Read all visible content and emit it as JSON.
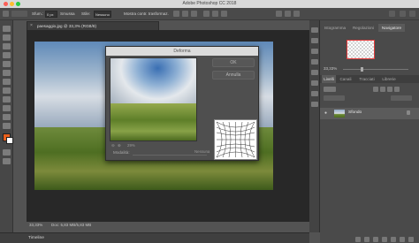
{
  "window": {
    "title": "Adobe Photoshop CC 2018"
  },
  "options_bar": {
    "feather_label": "Sfum.:",
    "feather_value": "0 px",
    "style_label": "Stile:",
    "style_value": "Nessuno",
    "smooth_label": "Smussa",
    "transform_button": "Mostra contr. trasformaz."
  },
  "document": {
    "tab_title": "paesaggio.jpg @ 33,3% (RGB/8)",
    "zoom_status": "33,33%",
    "doc_size": "Doc: 5,83 MB/5,83 MB"
  },
  "dialog": {
    "title": "Deforma",
    "ok_label": "OK",
    "cancel_label": "Annulla",
    "zoom_value": "29%",
    "mode_label": "Modalità:",
    "mode_value": "Nessuna"
  },
  "right_panel": {
    "tabs": [
      "Istogramma",
      "Regolazioni",
      "Navigatore"
    ],
    "active_tab": "Navigatore",
    "nav_zoom": "33,33%",
    "layer_tabs": [
      "Livelli",
      "Canali",
      "Tracciati",
      "Librerie"
    ],
    "layer_name": "Sfondo"
  },
  "timeline": {
    "label": "Timeline"
  },
  "colors": {
    "foreground": "#e85f1c",
    "background": "#ffffff",
    "accent_red": "#e23b3b"
  }
}
